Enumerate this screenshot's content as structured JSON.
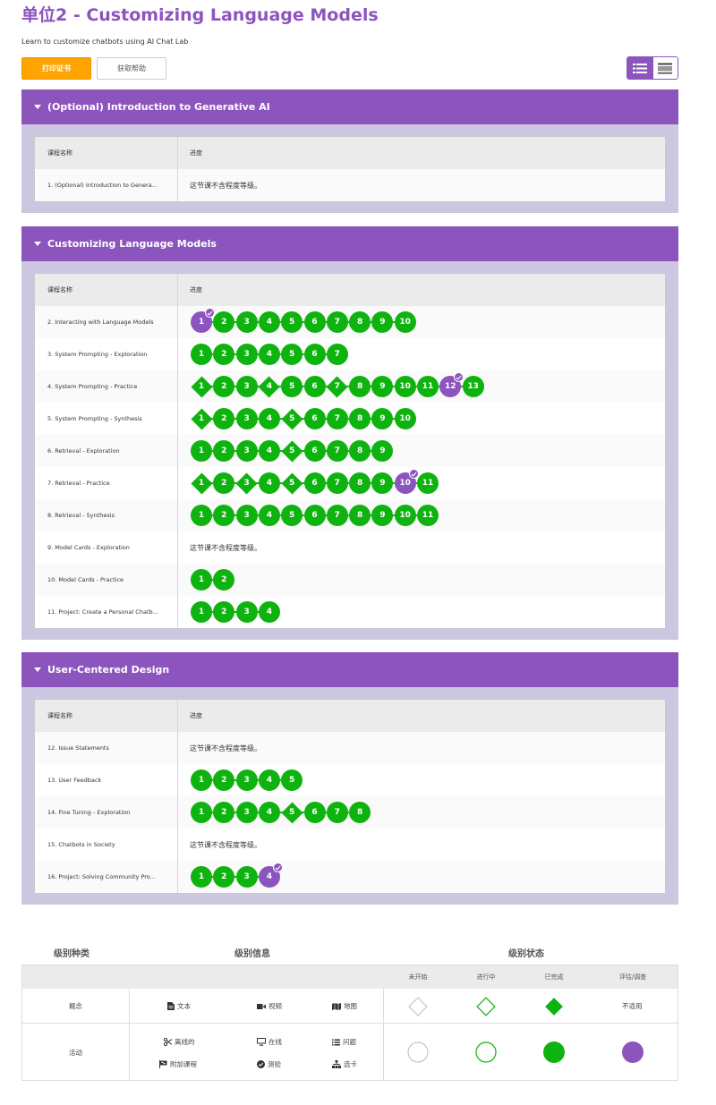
{
  "header": {
    "title": "单位2 - Customizing Language Models",
    "subtitle": "Learn to customize chatbots using AI Chat Lab",
    "print_button": "打印证书",
    "help_button": "获取帮助"
  },
  "table_headers": {
    "name": "课程名称",
    "progress": "进度"
  },
  "no_levels_text": "这节课不含程度等级。",
  "units": [
    {
      "title": "(Optional) Introduction to Generative AI",
      "lessons": [
        {
          "name": "1. (Optional) Introduction to Genera...",
          "levels": []
        }
      ]
    },
    {
      "title": "Customizing Language Models",
      "lessons": [
        {
          "name": "2. Interacting with Language Models",
          "levels": [
            {
              "n": "1",
              "shape": "circle",
              "status": "assessment"
            },
            {
              "n": "2",
              "shape": "circle",
              "status": "completed"
            },
            {
              "n": "3",
              "shape": "circle",
              "status": "completed"
            },
            {
              "n": "4",
              "shape": "circle",
              "status": "completed"
            },
            {
              "n": "5",
              "shape": "circle",
              "status": "completed"
            },
            {
              "n": "6",
              "shape": "circle",
              "status": "completed"
            },
            {
              "n": "7",
              "shape": "circle",
              "status": "completed"
            },
            {
              "n": "8",
              "shape": "circle",
              "status": "completed"
            },
            {
              "n": "9",
              "shape": "circle",
              "status": "completed"
            },
            {
              "n": "10",
              "shape": "circle",
              "status": "completed"
            }
          ]
        },
        {
          "name": "3. System Prompting - Exploration",
          "levels": [
            {
              "n": "1",
              "shape": "circle",
              "status": "completed"
            },
            {
              "n": "2",
              "shape": "circle",
              "status": "completed"
            },
            {
              "n": "3",
              "shape": "circle",
              "status": "completed"
            },
            {
              "n": "4",
              "shape": "circle",
              "status": "completed"
            },
            {
              "n": "5",
              "shape": "circle",
              "status": "completed"
            },
            {
              "n": "6",
              "shape": "circle",
              "status": "completed"
            },
            {
              "n": "7",
              "shape": "circle",
              "status": "completed"
            }
          ]
        },
        {
          "name": "4. System Prompting - Practice",
          "levels": [
            {
              "n": "1",
              "shape": "diamond",
              "status": "completed"
            },
            {
              "n": "2",
              "shape": "circle",
              "status": "completed"
            },
            {
              "n": "3",
              "shape": "circle",
              "status": "completed"
            },
            {
              "n": "4",
              "shape": "diamond",
              "status": "completed"
            },
            {
              "n": "5",
              "shape": "circle",
              "status": "completed"
            },
            {
              "n": "6",
              "shape": "circle",
              "status": "completed"
            },
            {
              "n": "7",
              "shape": "diamond",
              "status": "completed"
            },
            {
              "n": "8",
              "shape": "circle",
              "status": "completed"
            },
            {
              "n": "9",
              "shape": "circle",
              "status": "completed"
            },
            {
              "n": "10",
              "shape": "circle",
              "status": "completed"
            },
            {
              "n": "11",
              "shape": "circle",
              "status": "completed"
            },
            {
              "n": "12",
              "shape": "circle",
              "status": "assessment"
            },
            {
              "n": "13",
              "shape": "circle",
              "status": "completed"
            }
          ]
        },
        {
          "name": "5. System Prompting - Synthesis",
          "levels": [
            {
              "n": "1",
              "shape": "diamond",
              "status": "completed"
            },
            {
              "n": "2",
              "shape": "circle",
              "status": "completed"
            },
            {
              "n": "3",
              "shape": "circle",
              "status": "completed"
            },
            {
              "n": "4",
              "shape": "circle",
              "status": "completed"
            },
            {
              "n": "5",
              "shape": "diamond",
              "status": "completed"
            },
            {
              "n": "6",
              "shape": "circle",
              "status": "completed"
            },
            {
              "n": "7",
              "shape": "circle",
              "status": "completed"
            },
            {
              "n": "8",
              "shape": "circle",
              "status": "completed"
            },
            {
              "n": "9",
              "shape": "circle",
              "status": "completed"
            },
            {
              "n": "10",
              "shape": "circle",
              "status": "completed"
            }
          ]
        },
        {
          "name": "6. Retrieval - Exploration",
          "levels": [
            {
              "n": "1",
              "shape": "circle",
              "status": "completed"
            },
            {
              "n": "2",
              "shape": "circle",
              "status": "completed"
            },
            {
              "n": "3",
              "shape": "circle",
              "status": "completed"
            },
            {
              "n": "4",
              "shape": "circle",
              "status": "completed"
            },
            {
              "n": "5",
              "shape": "diamond",
              "status": "completed"
            },
            {
              "n": "6",
              "shape": "circle",
              "status": "completed"
            },
            {
              "n": "7",
              "shape": "circle",
              "status": "completed"
            },
            {
              "n": "8",
              "shape": "circle",
              "status": "completed"
            },
            {
              "n": "9",
              "shape": "circle",
              "status": "completed"
            }
          ]
        },
        {
          "name": "7. Retrieval - Practice",
          "levels": [
            {
              "n": "1",
              "shape": "diamond",
              "status": "completed"
            },
            {
              "n": "2",
              "shape": "circle",
              "status": "completed"
            },
            {
              "n": "3",
              "shape": "diamond",
              "status": "completed"
            },
            {
              "n": "4",
              "shape": "circle",
              "status": "completed"
            },
            {
              "n": "5",
              "shape": "diamond",
              "status": "completed"
            },
            {
              "n": "6",
              "shape": "circle",
              "status": "completed"
            },
            {
              "n": "7",
              "shape": "circle",
              "status": "completed"
            },
            {
              "n": "8",
              "shape": "circle",
              "status": "completed"
            },
            {
              "n": "9",
              "shape": "circle",
              "status": "completed"
            },
            {
              "n": "10",
              "shape": "circle",
              "status": "assessment"
            },
            {
              "n": "11",
              "shape": "circle",
              "status": "completed"
            }
          ]
        },
        {
          "name": "8. Retrieval - Synthesis",
          "levels": [
            {
              "n": "1",
              "shape": "circle",
              "status": "completed"
            },
            {
              "n": "2",
              "shape": "circle",
              "status": "completed"
            },
            {
              "n": "3",
              "shape": "circle",
              "status": "completed"
            },
            {
              "n": "4",
              "shape": "circle",
              "status": "completed"
            },
            {
              "n": "5",
              "shape": "circle",
              "status": "completed"
            },
            {
              "n": "6",
              "shape": "circle",
              "status": "completed"
            },
            {
              "n": "7",
              "shape": "circle",
              "status": "completed"
            },
            {
              "n": "8",
              "shape": "circle",
              "status": "completed"
            },
            {
              "n": "9",
              "shape": "circle",
              "status": "completed"
            },
            {
              "n": "10",
              "shape": "circle",
              "status": "completed"
            },
            {
              "n": "11",
              "shape": "circle",
              "status": "completed"
            }
          ]
        },
        {
          "name": "9. Model Cards - Exploration",
          "levels": []
        },
        {
          "name": "10. Model Cards - Practice",
          "levels": [
            {
              "n": "1",
              "shape": "circle",
              "status": "completed"
            },
            {
              "n": "2",
              "shape": "circle",
              "status": "completed"
            }
          ]
        },
        {
          "name": "11. Project: Create a Personal Chatb...",
          "levels": [
            {
              "n": "1",
              "shape": "circle",
              "status": "completed"
            },
            {
              "n": "2",
              "shape": "circle",
              "status": "completed"
            },
            {
              "n": "3",
              "shape": "circle",
              "status": "completed"
            },
            {
              "n": "4",
              "shape": "circle",
              "status": "completed"
            }
          ]
        }
      ]
    },
    {
      "title": "User-Centered Design",
      "lessons": [
        {
          "name": "12. Issue Statements",
          "levels": []
        },
        {
          "name": "13. User Feedback",
          "levels": [
            {
              "n": "1",
              "shape": "circle",
              "status": "completed"
            },
            {
              "n": "2",
              "shape": "circle",
              "status": "completed"
            },
            {
              "n": "3",
              "shape": "circle",
              "status": "completed"
            },
            {
              "n": "4",
              "shape": "circle",
              "status": "completed"
            },
            {
              "n": "5",
              "shape": "circle",
              "status": "completed"
            }
          ]
        },
        {
          "name": "14. Fine Tuning - Exploration",
          "levels": [
            {
              "n": "1",
              "shape": "circle",
              "status": "completed"
            },
            {
              "n": "2",
              "shape": "circle",
              "status": "completed"
            },
            {
              "n": "3",
              "shape": "circle",
              "status": "completed"
            },
            {
              "n": "4",
              "shape": "circle",
              "status": "completed"
            },
            {
              "n": "5",
              "shape": "diamond",
              "status": "completed"
            },
            {
              "n": "6",
              "shape": "circle",
              "status": "completed"
            },
            {
              "n": "7",
              "shape": "circle",
              "status": "completed"
            },
            {
              "n": "8",
              "shape": "circle",
              "status": "completed"
            }
          ]
        },
        {
          "name": "15. Chatbots in Society",
          "levels": []
        },
        {
          "name": "16. Project: Solving Community Pro...",
          "levels": [
            {
              "n": "1",
              "shape": "circle",
              "status": "completed"
            },
            {
              "n": "2",
              "shape": "circle",
              "status": "completed"
            },
            {
              "n": "3",
              "shape": "circle",
              "status": "completed"
            },
            {
              "n": "4",
              "shape": "circle",
              "status": "assessment"
            }
          ]
        }
      ]
    }
  ],
  "legend": {
    "type_heading": "级别种类",
    "info_heading": "级别信息",
    "status_heading": "级别状态",
    "status_columns": [
      "未开始",
      "进行中",
      "已完成",
      "评估/调查"
    ],
    "concept_label": "概念",
    "activity_label": "活动",
    "concept_items": [
      "文本",
      "视频",
      "地图"
    ],
    "activity_items": [
      "离线的",
      "在线",
      "问题",
      "附加课程",
      "测验",
      "选卡"
    ],
    "not_applicable": "不适用"
  },
  "colors": {
    "brand": "#8c54bd",
    "completed": "#0fb30f",
    "print": "#ffa400"
  }
}
